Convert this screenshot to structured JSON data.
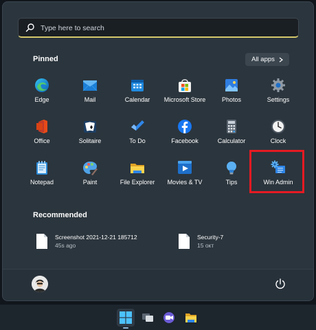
{
  "search": {
    "placeholder": "Type here to search"
  },
  "pinned": {
    "title": "Pinned",
    "all_apps_label": "All apps",
    "apps": [
      {
        "label": "Edge",
        "icon": "edge-icon"
      },
      {
        "label": "Mail",
        "icon": "mail-icon"
      },
      {
        "label": "Calendar",
        "icon": "calendar-icon"
      },
      {
        "label": "Microsoft Store",
        "icon": "store-icon"
      },
      {
        "label": "Photos",
        "icon": "photos-icon"
      },
      {
        "label": "Settings",
        "icon": "gear-icon"
      },
      {
        "label": "Office",
        "icon": "office-icon"
      },
      {
        "label": "Solitaire",
        "icon": "cards-icon"
      },
      {
        "label": "To Do",
        "icon": "checkmark-icon"
      },
      {
        "label": "Facebook",
        "icon": "facebook-icon"
      },
      {
        "label": "Calculator",
        "icon": "calculator-icon"
      },
      {
        "label": "Clock",
        "icon": "clock-icon"
      },
      {
        "label": "Notepad",
        "icon": "notepad-icon"
      },
      {
        "label": "Paint",
        "icon": "palette-icon"
      },
      {
        "label": "File Explorer",
        "icon": "folder-icon"
      },
      {
        "label": "Movies & TV",
        "icon": "play-icon"
      },
      {
        "label": "Tips",
        "icon": "lightbulb-icon"
      },
      {
        "label": "Win Admin",
        "icon": "admin-gears-icon"
      }
    ]
  },
  "recommended": {
    "title": "Recommended",
    "items": [
      {
        "name": "Screenshot 2021-12-21 185712",
        "time": "45s ago"
      },
      {
        "name": "Security-7",
        "time": "15 окт"
      }
    ]
  },
  "colors": {
    "highlight": "#e51a22",
    "search_underline": "#d6c96b",
    "panel": "#2b353d"
  }
}
